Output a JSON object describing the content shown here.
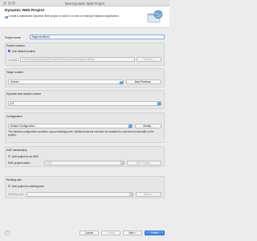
{
  "window": {
    "title": "New Dynamic Web Project"
  },
  "header": {
    "title": "Dynamic Web Project",
    "description": "Create a standalone Dynamic Web project or add it to a new or existing Enterprise Application."
  },
  "project": {
    "name_label": "Project name:",
    "name_value": "BeginnersBook"
  },
  "location": {
    "section_label": "Project location",
    "use_default_label": "Use default location",
    "use_default_checked": true,
    "location_label": "Location:",
    "location_value": "/Users/chaitanyasingh/Documents/workspace/BeginnersBook",
    "browse_label": "Browse..."
  },
  "runtime": {
    "section_label": "Target runtime",
    "selected": "<None>",
    "new_runtime_label": "New Runtime..."
  },
  "module": {
    "section_label": "Dynamic web module version",
    "selected": "3.0"
  },
  "configuration": {
    "section_label": "Configuration",
    "selected": "Default Configuration",
    "modify_label": "Modify...",
    "description": "The default configuration provides a good starting point. Additional facets can later be installed to add new functionality to the project."
  },
  "ear": {
    "section_label": "EAR membership",
    "add_label": "Add project to an EAR",
    "add_checked": false,
    "ear_name_label": "EAR project name:",
    "ear_name_value": "EAR",
    "new_project_label": "New Project..."
  },
  "working_sets": {
    "section_label": "Working sets",
    "add_label": "Add project to working sets",
    "add_checked": false,
    "sets_label": "Working sets:",
    "select_label": "Select..."
  },
  "footer": {
    "help_glyph": "?",
    "cancel_label": "Cancel",
    "back_label": "< Back",
    "next_label": "Next >",
    "finish_label": "Finish"
  },
  "colors": {
    "accent": "#3c82f0",
    "background": "#ececec"
  },
  "icons": [
    "window-close-icon",
    "window-minimize-icon",
    "window-zoom-icon",
    "globe-banner-icon",
    "info-icon",
    "help-icon",
    "checkmark-icon",
    "select-arrows-icon"
  ]
}
